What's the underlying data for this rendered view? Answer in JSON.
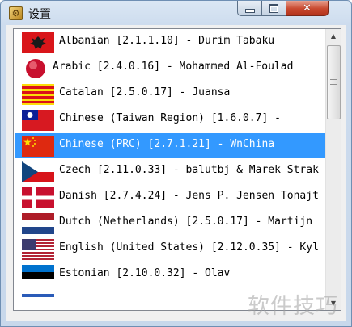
{
  "window": {
    "title": "设置",
    "app_icon_glyph": "⚙",
    "minimize_icon": "minimize-icon",
    "maximize_icon": "maximize-icon",
    "close_glyph": "✕"
  },
  "languages": [
    {
      "label": "Albanian [2.1.1.10] - Durim Tabaku",
      "flag": "albania-flag-icon",
      "selected": false
    },
    {
      "label": "Arabic [2.4.0.16] - Mohammed Al-Foulad",
      "flag": "arabic-flag-icon",
      "selected": false
    },
    {
      "label": "Catalan [2.5.0.17] - Juansa",
      "flag": "catalonia-flag-icon",
      "selected": false
    },
    {
      "label": "Chinese (Taiwan Region) [1.6.0.7] -",
      "flag": "taiwan-flag-icon",
      "selected": false
    },
    {
      "label": "Chinese (PRC) [2.7.1.21] - WnChina",
      "flag": "china-flag-icon",
      "selected": true
    },
    {
      "label": "Czech [2.11.0.33] - balutbj & Marek Strak",
      "flag": "czech-flag-icon",
      "selected": false
    },
    {
      "label": "Danish [2.7.4.24] - Jens P. Jensen Tonajt",
      "flag": "denmark-flag-icon",
      "selected": false
    },
    {
      "label": "Dutch (Netherlands) [2.5.0.17] - Martijn",
      "flag": "netherlands-flag-icon",
      "selected": false
    },
    {
      "label": "English (United States) [2.12.0.35] - Kyl",
      "flag": "usa-flag-icon",
      "selected": false
    },
    {
      "label": "Estonian [2.10.0.32] - Olav",
      "flag": "estonia-flag-icon",
      "selected": false
    }
  ],
  "colors": {
    "selection": "#3399ff",
    "selection_text": "#ffffff"
  },
  "watermark": "软件技巧"
}
